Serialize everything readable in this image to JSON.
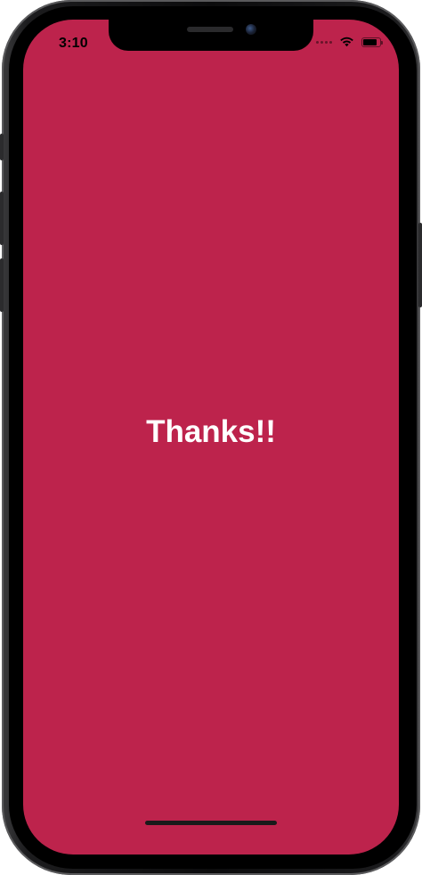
{
  "status_bar": {
    "time": "3:10",
    "wifi_icon": "wifi-icon",
    "battery_icon": "battery-icon",
    "battery_level": 0.85
  },
  "screen": {
    "message": "Thanks!!",
    "background_color": "#BD234C",
    "text_color": "#FFFFFF"
  }
}
